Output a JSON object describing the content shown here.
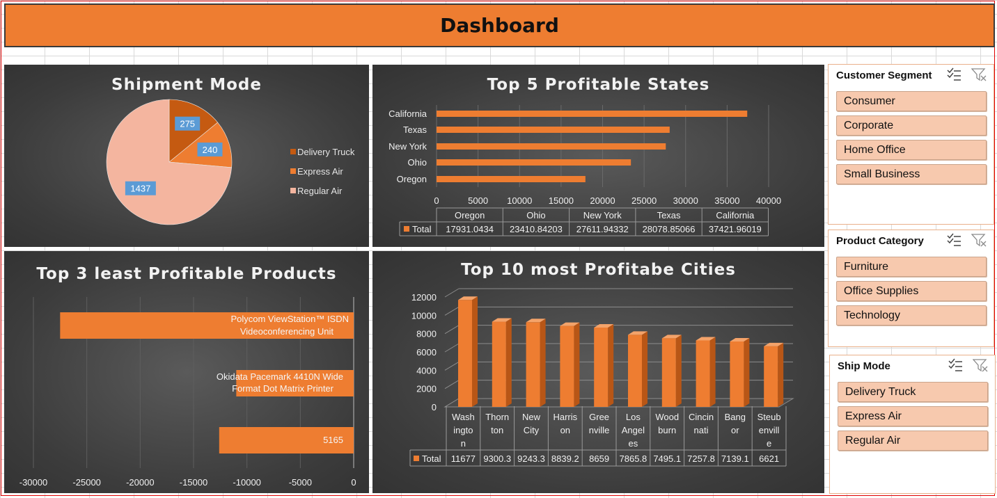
{
  "dashboard_title": "Dashboard",
  "colors": {
    "accent": "#ee7d31",
    "panel_bg": "#404040",
    "slicer_item": "#f7c9ae"
  },
  "slicers": [
    {
      "title": "Customer Segment",
      "items": [
        "Consumer",
        "Corporate",
        "Home Office",
        "Small Business"
      ]
    },
    {
      "title": "Product Category",
      "items": [
        "Furniture",
        "Office Supplies",
        "Technology"
      ]
    },
    {
      "title": "Ship Mode",
      "items": [
        "Delivery Truck",
        "Express Air",
        "Regular Air"
      ]
    }
  ],
  "slicer_icons": [
    "multi-select-icon",
    "clear-filter-icon"
  ],
  "chart_data": [
    {
      "type": "pie",
      "title": "Shipment Mode",
      "categories": [
        "Delivery Truck",
        "Express Air",
        "Regular Air"
      ],
      "values": [
        275,
        240,
        1437
      ],
      "colors": [
        "#c55a11",
        "#ee7d31",
        "#f4b59f"
      ],
      "legend": "right"
    },
    {
      "type": "bar",
      "orientation": "horizontal",
      "title": "Top 5 Profitable States",
      "categories": [
        "Oregon",
        "Ohio",
        "New York",
        "Texas",
        "California"
      ],
      "series": [
        {
          "name": "Total",
          "values": [
            17931.0434,
            23410.84203,
            27611.94332,
            28078.85066,
            37421.96019
          ]
        }
      ],
      "value_labels": [
        "17931.0434",
        "23410.84203",
        "27611.94332",
        "28078.85066",
        "37421.96019"
      ],
      "xlim": [
        0,
        40000
      ],
      "x_ticks": [
        "0",
        "5000",
        "10000",
        "15000",
        "20000",
        "25000",
        "30000",
        "35000",
        "40000"
      ],
      "data_table": true,
      "grid": true
    },
    {
      "type": "bar",
      "orientation": "horizontal",
      "title": "Top 3 least Profitable Products",
      "categories": [
        "Polycom ViewStation™ ISDN Videoconferencing Unit",
        "Okidata Pacemark 4410N Wide Format Dot Matrix Printer",
        "5165"
      ],
      "values": [
        -27500,
        -11000,
        -12600
      ],
      "xlim": [
        -30000,
        0
      ],
      "x_ticks": [
        "-30000",
        "-25000",
        "-20000",
        "-15000",
        "-10000",
        "-5000",
        "0"
      ],
      "grid": true
    },
    {
      "type": "bar",
      "style": "3d-column",
      "title": "Top 10 most Profitabe Cities",
      "categories": [
        "Washington",
        "Thornton",
        "New City",
        "Harrison",
        "Greenville",
        "Los Angeles",
        "Woodburn",
        "Cincinnati",
        "Bangor",
        "Steubenville"
      ],
      "category_label_lines": [
        [
          "Wash",
          "ingto",
          "n"
        ],
        [
          "Thorn",
          "ton"
        ],
        [
          "New",
          "City"
        ],
        [
          "Harris",
          "on"
        ],
        [
          "Gree",
          "nville"
        ],
        [
          "Los",
          "Angel",
          "es"
        ],
        [
          "Wood",
          "burn"
        ],
        [
          "Cincin",
          "nati"
        ],
        [
          "Bang",
          "or"
        ],
        [
          "Steub",
          "envill",
          "e"
        ]
      ],
      "series": [
        {
          "name": "Total",
          "values": [
            11677,
            9300.3,
            9243.3,
            8839.2,
            8659,
            7865.8,
            7495.1,
            7257.8,
            7139.1,
            6621
          ]
        }
      ],
      "value_labels": [
        "11677",
        "9300.3",
        "9243.3",
        "8839.2",
        "8659",
        "7865.8",
        "7495.1",
        "7257.8",
        "7139.1",
        "6621"
      ],
      "ylim": [
        0,
        12000
      ],
      "y_ticks": [
        "0",
        "2000",
        "4000",
        "6000",
        "8000",
        "10000",
        "12000"
      ],
      "data_table": true,
      "grid": true
    }
  ]
}
